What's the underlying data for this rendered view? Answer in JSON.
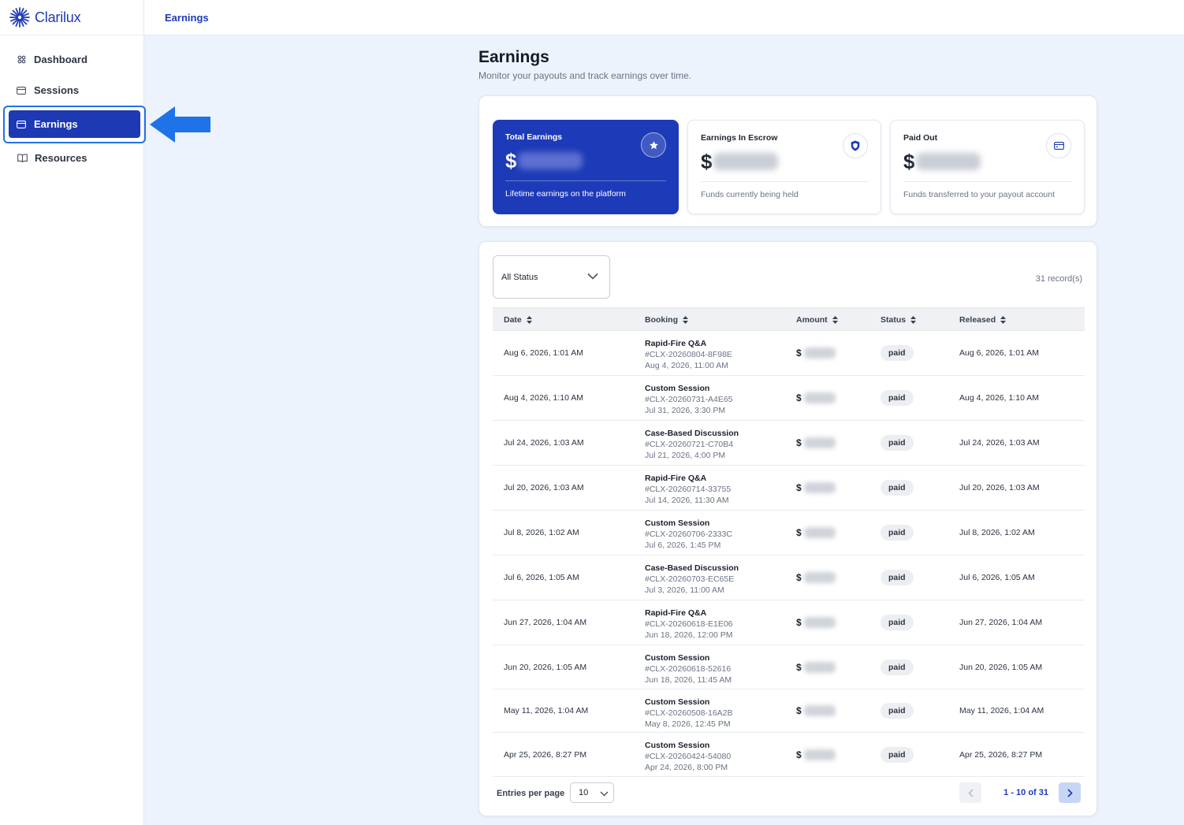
{
  "brand": {
    "name": "Clarilux",
    "logo_icon": "sunburst-logo"
  },
  "sidebar": {
    "items": [
      {
        "label": "Dashboard",
        "icon": "grid-icon",
        "active": false
      },
      {
        "label": "Sessions",
        "icon": "card-icon",
        "active": false
      },
      {
        "label": "Earnings",
        "icon": "credit-card-icon",
        "active": true
      },
      {
        "label": "Resources",
        "icon": "book-icon",
        "active": false
      }
    ]
  },
  "topbar": {
    "title": "Earnings"
  },
  "page": {
    "title": "Earnings",
    "subtitle": "Monitor your payouts and track earnings over time."
  },
  "stats": [
    {
      "label": "Total Earnings",
      "currency": "$",
      "note": "Lifetime earnings on the platform",
      "icon": "star-icon"
    },
    {
      "label": "Earnings In Escrow",
      "currency": "$",
      "note": "Funds currently being held",
      "icon": "shield-icon"
    },
    {
      "label": "Paid Out",
      "currency": "$",
      "note": "Funds transferred to your payout account",
      "icon": "credit-card-icon"
    }
  ],
  "filter": {
    "status_value": "All Status"
  },
  "records_count": "31 record(s)",
  "table": {
    "columns": [
      "Date",
      "Booking",
      "Amount",
      "Status",
      "Released"
    ],
    "currency": "$",
    "rows": [
      {
        "date": "Aug 6, 2026, 1:01 AM",
        "title": "Rapid-Fire Q&A",
        "id": "#CLX-20260804-8F98E",
        "time": "Aug 4, 2026, 11:00 AM",
        "status": "paid",
        "released": "Aug 6, 2026, 1:01 AM"
      },
      {
        "date": "Aug 4, 2026, 1:10 AM",
        "title": "Custom Session",
        "id": "#CLX-20260731-A4E65",
        "time": "Jul 31, 2026, 3:30 PM",
        "status": "paid",
        "released": "Aug 4, 2026, 1:10 AM"
      },
      {
        "date": "Jul 24, 2026, 1:03 AM",
        "title": "Case-Based Discussion",
        "id": "#CLX-20260721-C70B4",
        "time": "Jul 21, 2026, 4:00 PM",
        "status": "paid",
        "released": "Jul 24, 2026, 1:03 AM"
      },
      {
        "date": "Jul 20, 2026, 1:03 AM",
        "title": "Rapid-Fire Q&A",
        "id": "#CLX-20260714-33755",
        "time": "Jul 14, 2026, 11:30 AM",
        "status": "paid",
        "released": "Jul 20, 2026, 1:03 AM"
      },
      {
        "date": "Jul 8, 2026, 1:02 AM",
        "title": "Custom Session",
        "id": "#CLX-20260706-2333C",
        "time": "Jul 6, 2026, 1:45 PM",
        "status": "paid",
        "released": "Jul 8, 2026, 1:02 AM"
      },
      {
        "date": "Jul 6, 2026, 1:05 AM",
        "title": "Case-Based Discussion",
        "id": "#CLX-20260703-EC65E",
        "time": "Jul 3, 2026, 11:00 AM",
        "status": "paid",
        "released": "Jul 6, 2026, 1:05 AM"
      },
      {
        "date": "Jun 27, 2026, 1:04 AM",
        "title": "Rapid-Fire Q&A",
        "id": "#CLX-20260618-E1E06",
        "time": "Jun 18, 2026, 12:00 PM",
        "status": "paid",
        "released": "Jun 27, 2026, 1:04 AM"
      },
      {
        "date": "Jun 20, 2026, 1:05 AM",
        "title": "Custom Session",
        "id": "#CLX-20260618-52616",
        "time": "Jun 18, 2026, 11:45 AM",
        "status": "paid",
        "released": "Jun 20, 2026, 1:05 AM"
      },
      {
        "date": "May 11, 2026, 1:04 AM",
        "title": "Custom Session",
        "id": "#CLX-20260508-16A2B",
        "time": "May 8, 2026, 12:45 PM",
        "status": "paid",
        "released": "May 11, 2026, 1:04 AM"
      },
      {
        "date": "Apr 25, 2026, 8:27 PM",
        "title": "Custom Session",
        "id": "#CLX-20260424-54080",
        "time": "Apr 24, 2026, 8:00 PM",
        "status": "paid",
        "released": "Apr 25, 2026, 8:27 PM"
      }
    ]
  },
  "pagination": {
    "entries_label": "Entries per page",
    "entries_value": "10",
    "range": "1 - 10 of 31"
  },
  "colors": {
    "brand": "#1d3ab8",
    "accent": "#1e73e8",
    "background": "#edf3fc"
  }
}
